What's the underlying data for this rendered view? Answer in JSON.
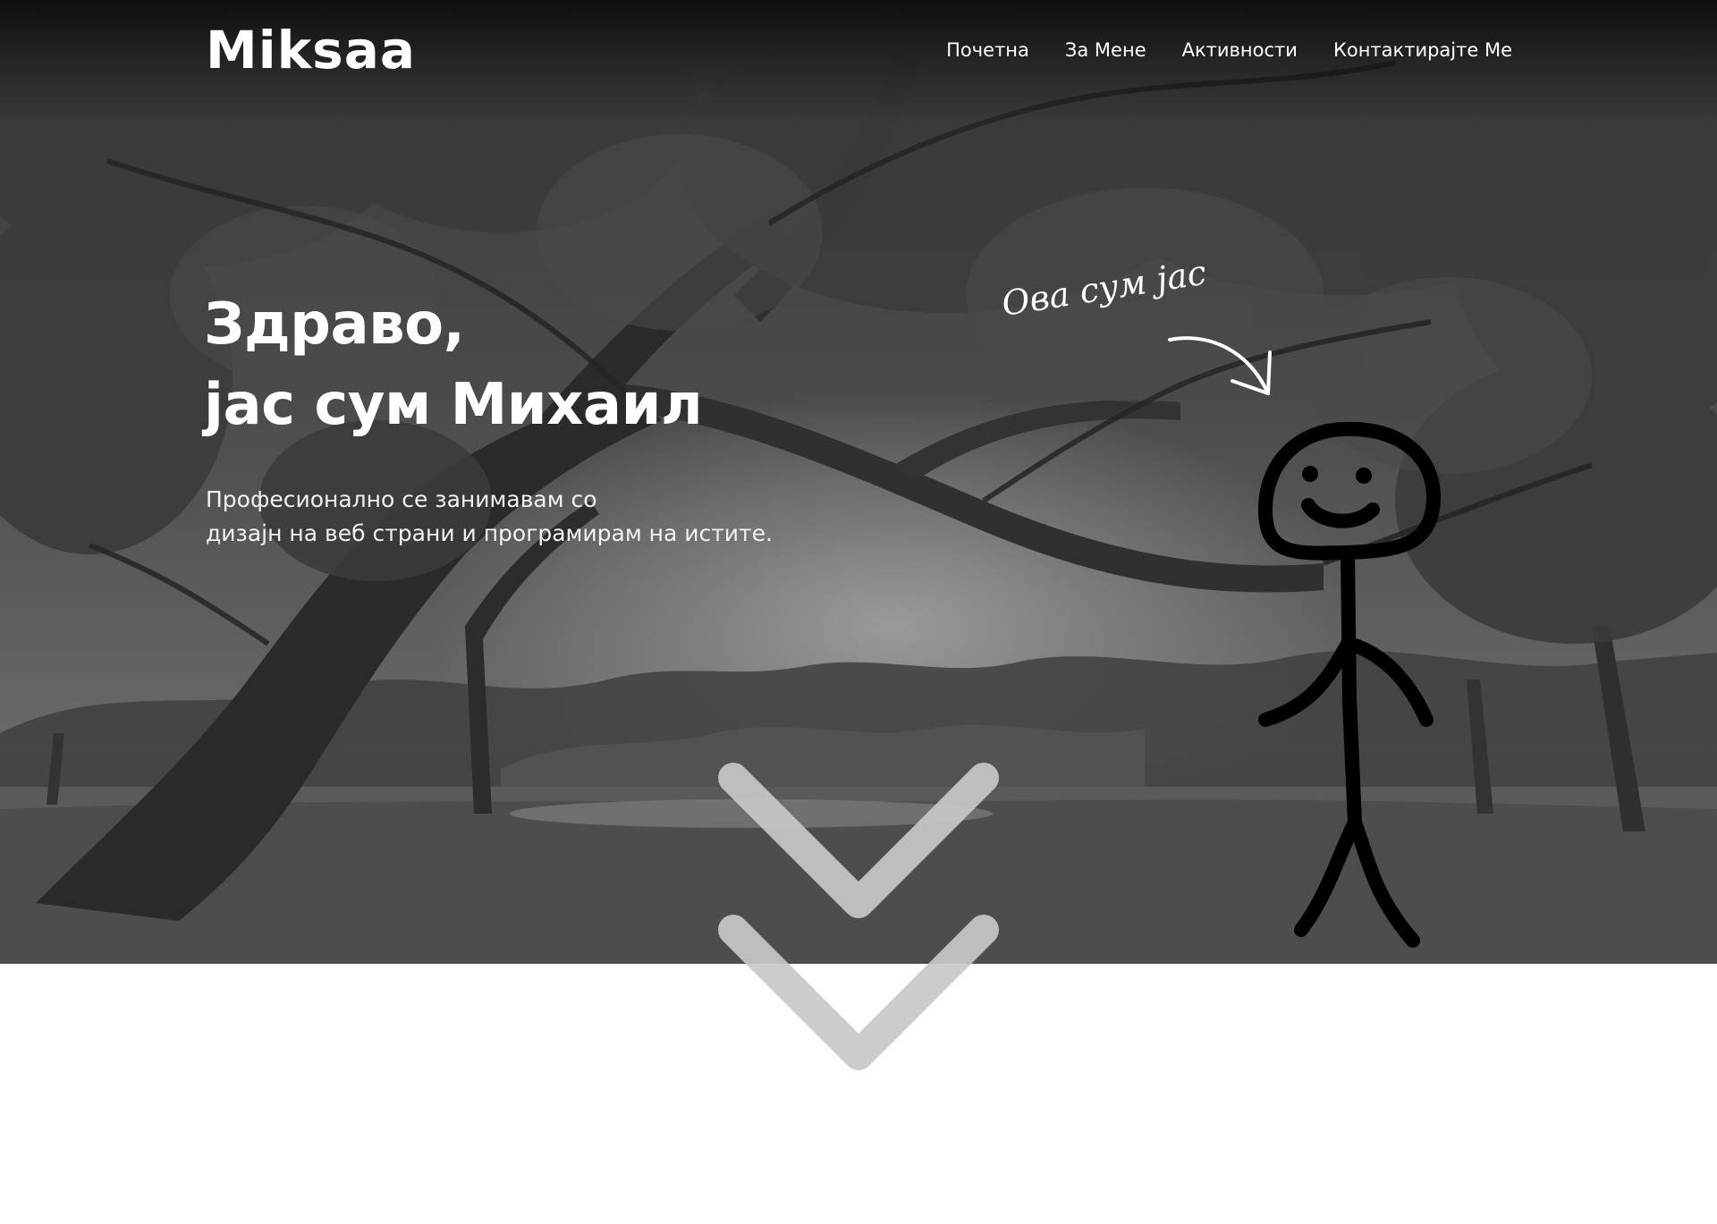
{
  "header": {
    "logo": "Miksaa",
    "nav": [
      "Почетна",
      "За Мене",
      "Активности",
      "Контактирајте Ме"
    ]
  },
  "hero": {
    "headline_line1": "Здраво,",
    "headline_line2": "јас сум Михаил",
    "subtitle_line1": "Професионално се занимавам со",
    "subtitle_line2": "дизајн на веб страни и програмирам на истите.",
    "handwritten_note": "Ова сум јас"
  },
  "icons": {
    "scroll": "double-chevron-down-icon",
    "arrow": "curved-arrow-icon",
    "figure": "stick-figure-illustration"
  },
  "colors": {
    "text": "#ffffff",
    "chevron": "#c8c8c8",
    "page_bg": "#ffffff"
  }
}
